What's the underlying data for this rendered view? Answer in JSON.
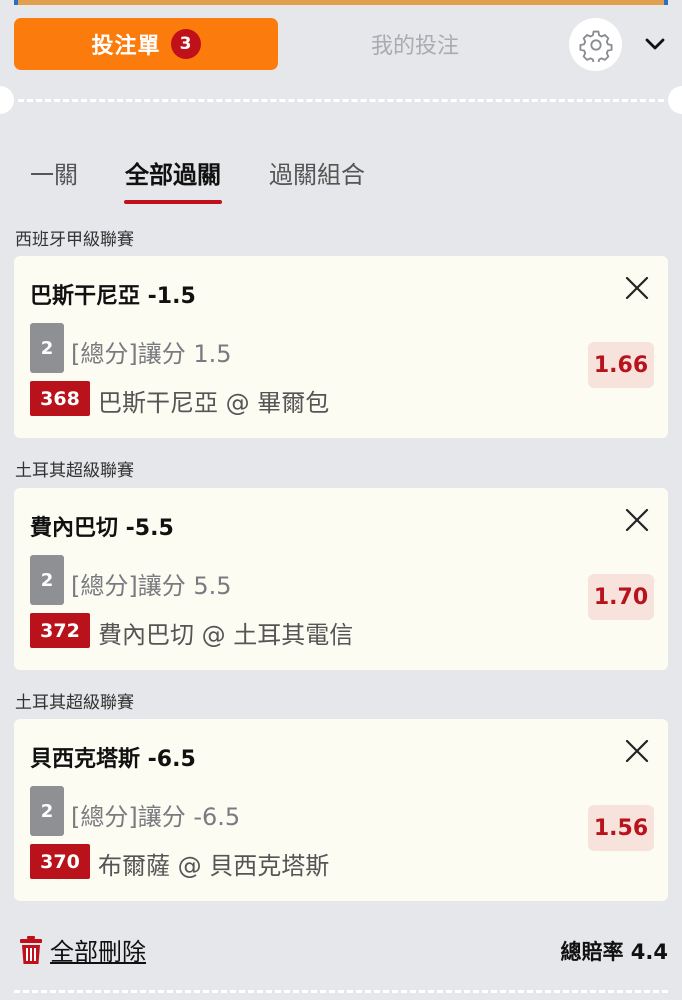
{
  "header": {
    "bet_slip_label": "投注單",
    "bet_slip_count": "3",
    "my_bets_label": "我的投注"
  },
  "mode_tabs": [
    {
      "label": "一關",
      "active": false
    },
    {
      "label": "全部過關",
      "active": true
    },
    {
      "label": "過關組合",
      "active": false
    }
  ],
  "bets": [
    {
      "league": "西班牙甲級聯賽",
      "selection": "巴斯干尼亞 -1.5",
      "period": "2",
      "market": "[總分]讓分 1.5",
      "match_no": "368",
      "match": "巴斯干尼亞 @ 畢爾包",
      "odds": "1.66"
    },
    {
      "league": "土耳其超級聯賽",
      "selection": "費內巴切 -5.5",
      "period": "2",
      "market": "[總分]讓分 5.5",
      "match_no": "372",
      "match": "費內巴切 @ 土耳其電信",
      "odds": "1.70"
    },
    {
      "league": "土耳其超級聯賽",
      "selection": "貝西克塔斯 -6.5",
      "period": "2",
      "market": "[總分]讓分 -6.5",
      "match_no": "370",
      "match": "布爾薩 @ 貝西克塔斯",
      "odds": "1.56"
    }
  ],
  "footer": {
    "delete_all_label": "全部刪除",
    "total_odds_label": "總賠率",
    "total_odds_value": "4.4"
  },
  "colors": {
    "accent_orange": "#fb7b0d",
    "brand_red": "#c0111a",
    "odds_bg": "#f8e2dc",
    "card_bg": "#fdfcf2",
    "page_bg": "#e6e7ea"
  },
  "icons": {
    "settings": "gear-icon",
    "collapse": "chevron-down-icon",
    "remove": "close-icon",
    "delete": "trash-icon"
  }
}
